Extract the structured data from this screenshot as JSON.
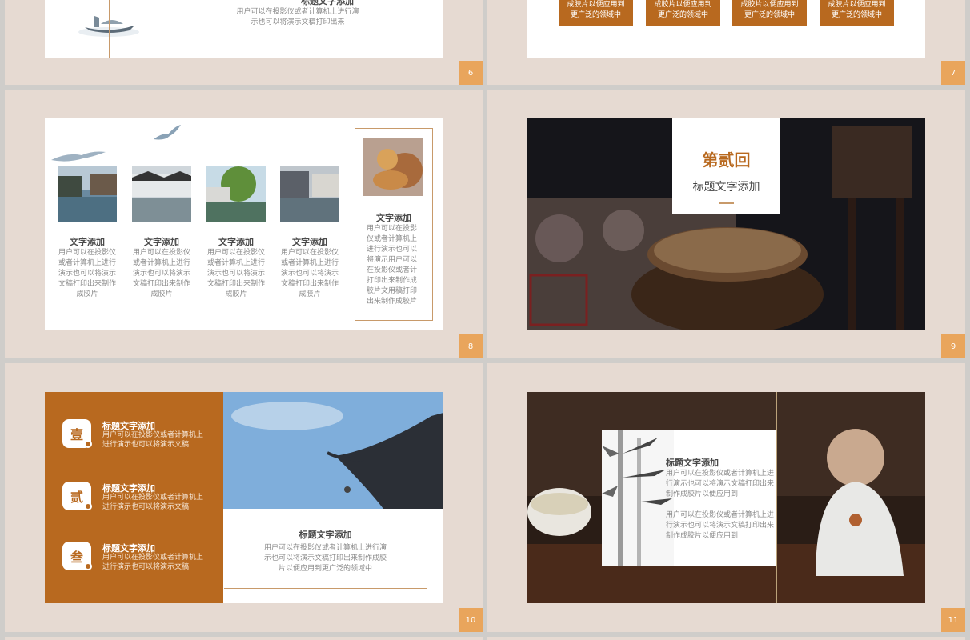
{
  "slides": {
    "s6": {
      "number": "6",
      "title": "标题文字添加",
      "body": "用户可以在投影仪或者计算机上进行演示也可以将演示文稿打印出来"
    },
    "s7": {
      "number": "7",
      "boxes": [
        {
          "line1": "成胶片以便应用到",
          "line2": "更广泛的领域中"
        },
        {
          "line1": "成胶片以便应用到",
          "line2": "更广泛的领域中"
        },
        {
          "line1": "成胶片以便应用到",
          "line2": "更广泛的领域中"
        },
        {
          "line1": "成胶片以便应用到",
          "line2": "更广泛的领域中"
        }
      ]
    },
    "s8": {
      "number": "8",
      "items": [
        {
          "title": "文字添加",
          "body": "用户可以在投影仪或者计算机上进行演示也可以将演示文稿打印出来制作成胶片"
        },
        {
          "title": "文字添加",
          "body": "用户可以在投影仪或者计算机上进行演示也可以将演示文稿打印出来制作成胶片"
        },
        {
          "title": "文字添加",
          "body": "用户可以在投影仪或者计算机上进行演示也可以将演示文稿打印出来制作成胶片"
        },
        {
          "title": "文字添加",
          "body": "用户可以在投影仪或者计算机上进行演示也可以将演示文稿打印出来制作成胶片"
        }
      ],
      "side": {
        "title": "文字添加",
        "body": "用户可以在投影仪或者计算机上进行演示也可以将演示用户可以在投影仪或者计打印出来制作成胶片文用稿打印出来制作成胶片"
      }
    },
    "s9": {
      "number": "9",
      "big": "第贰回",
      "sub": "标题文字添加"
    },
    "s10": {
      "number": "10",
      "items": [
        {
          "badge": "壹",
          "title": "标题文字添加",
          "line1": "用户可以在投影仪或者计算机上",
          "line2": "进行演示也可以将演示文稿"
        },
        {
          "badge": "贰",
          "title": "标题文字添加",
          "line1": "用户可以在投影仪或者计算机上",
          "line2": "进行演示也可以将演示文稿"
        },
        {
          "badge": "叁",
          "title": "标题文字添加",
          "line1": "用户可以在投影仪或者计算机上",
          "line2": "进行演示也可以将演示文稿"
        }
      ],
      "card": {
        "title": "标题文字添加",
        "line1": "用户可以在投影仪或者计算机上进行演",
        "line2": "示也可以将演示文稿打印出来制作成胶",
        "line3": "片以便应用到更广泛的领域中"
      }
    },
    "s11": {
      "number": "11",
      "title": "标题文字添加",
      "para1": [
        "用户可以在投影仪或者计算机上进",
        "行演示也可以将演示文稿打印出来",
        "制作成胶片以便应用到"
      ],
      "para2": [
        "用户可以在投影仪或者计算机上进",
        "行演示也可以将演示文稿打印出来",
        "制作成胶片以便应用到"
      ]
    }
  },
  "colors": {
    "accent": "#b8691f",
    "number_badge": "#e9a55c",
    "cell_bg": "#e6dad2",
    "frame_line": "#c89a6a"
  }
}
